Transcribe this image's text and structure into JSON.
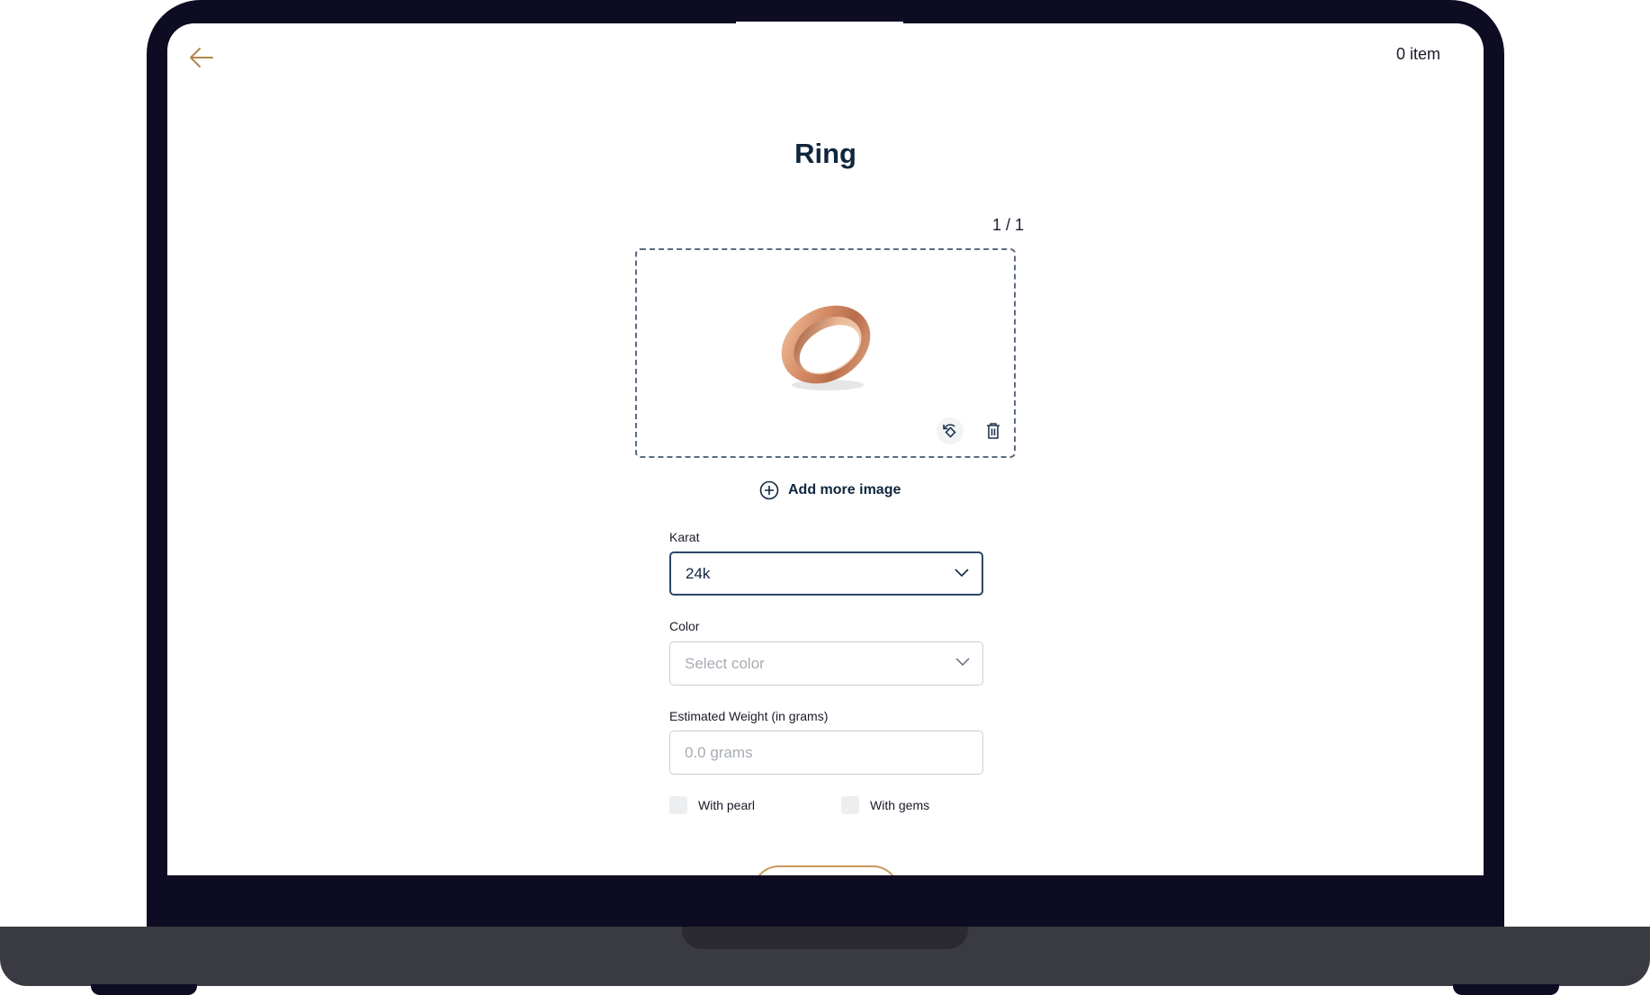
{
  "header": {
    "back_icon": "arrow-left-icon",
    "cart_count": "0 item"
  },
  "page": {
    "title": "Ring"
  },
  "image_gallery": {
    "counter": "1 / 1",
    "image_subject": "rose-gold-ring",
    "rotate_icon": "rotate-icon",
    "delete_icon": "trash-icon",
    "add_more_label": "Add more image",
    "add_icon": "plus-circle-icon"
  },
  "form": {
    "karat": {
      "label": "Karat",
      "value": "24k"
    },
    "color": {
      "label": "Color",
      "placeholder": "Select color"
    },
    "weight": {
      "label": "Estimated Weight (in grams)",
      "placeholder": "0.0 grams"
    },
    "with_pearl": {
      "label": "With pearl",
      "checked": false
    },
    "with_gems": {
      "label": "With gems",
      "checked": false
    }
  },
  "colors": {
    "accent": "#c9975f",
    "primary_text": "#10263d",
    "frame": "#0d0c22"
  }
}
